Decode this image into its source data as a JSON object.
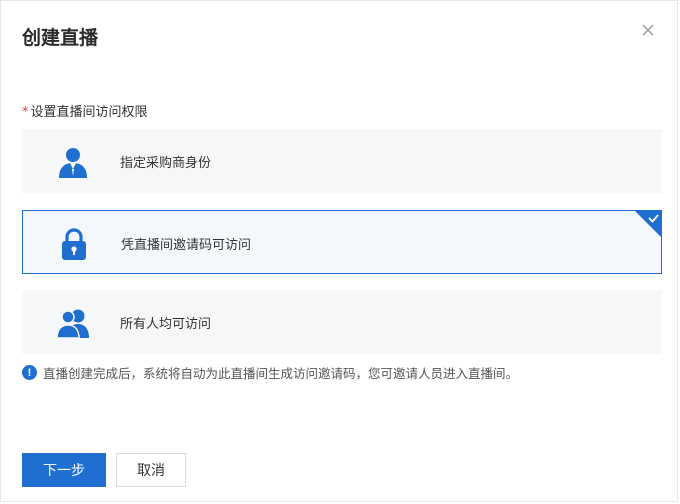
{
  "dialog": {
    "title": "创建直播",
    "close_icon": "close-icon"
  },
  "access": {
    "required_mark": "*",
    "label": "设置直播间访问权限",
    "options": [
      {
        "label": "指定采购商身份",
        "icon": "user-icon",
        "selected": false
      },
      {
        "label": "凭直播间邀请码可访问",
        "icon": "lock-icon",
        "selected": true
      },
      {
        "label": "所有人均可访问",
        "icon": "users-icon",
        "selected": false
      }
    ]
  },
  "notice": {
    "icon_text": "!",
    "text": "直播创建完成后，系统将自动为此直播间生成访问邀请码，您可邀请人员进入直播间。"
  },
  "footer": {
    "next_label": "下一步",
    "cancel_label": "取消"
  },
  "colors": {
    "primary": "#1f6fd1",
    "required": "#e4393c",
    "option_bg": "#f6f7f9"
  }
}
